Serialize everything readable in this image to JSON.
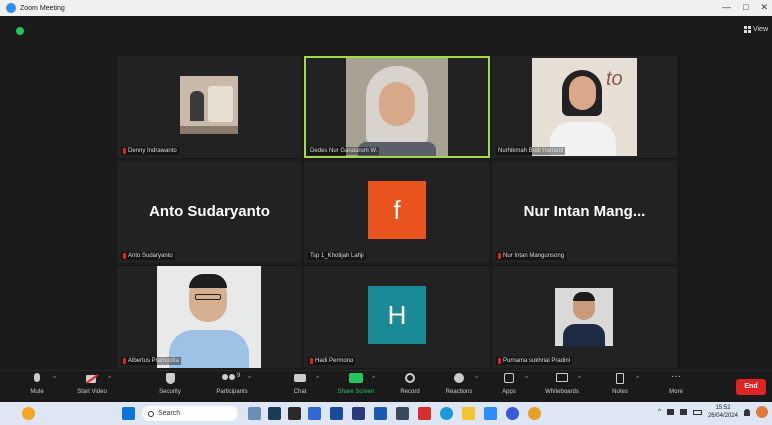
{
  "window": {
    "title": "Zoom Meeting",
    "controls": [
      "—",
      "□",
      "✕"
    ]
  },
  "view_label": "View",
  "participants": [
    {
      "name": "Denny Indrawanto",
      "muted": true
    },
    {
      "name": "Dedes Nur Gandarum W.",
      "muted": false,
      "active": true
    },
    {
      "name": "Nurhikmah Budi Hartanti",
      "muted": false
    },
    {
      "name": "Anto Sudaryanto",
      "display": "Anto Sudaryanto",
      "muted": true
    },
    {
      "name": "Tsp 1_Khotijah Lahji",
      "avatar": "f",
      "avatar_color": "#e8531e",
      "muted": false
    },
    {
      "name": "Nur Intan Mangunsong",
      "display": "Nur Intan Mang...",
      "muted": true
    },
    {
      "name": "Albertus Pramudita",
      "muted": true
    },
    {
      "name": "Hadi Permono",
      "avatar": "H",
      "avatar_color": "#1a8a96",
      "muted": true
    },
    {
      "name": "Purnama sukhrial Pradini",
      "muted": true
    }
  ],
  "toolbar": {
    "mute": "Mute",
    "start_video": "Start Video",
    "security": "Security",
    "participants": "Participants",
    "participants_count": "9",
    "chat": "Chat",
    "share_screen": "Share Screen",
    "record": "Record",
    "reactions": "Reactions",
    "apps": "Apps",
    "whiteboards": "Whiteboards",
    "notes": "Notes",
    "more": "More",
    "end": "End"
  },
  "taskbar": {
    "search_placeholder": "Search",
    "time": "15:52",
    "date": "26/04/2024"
  }
}
